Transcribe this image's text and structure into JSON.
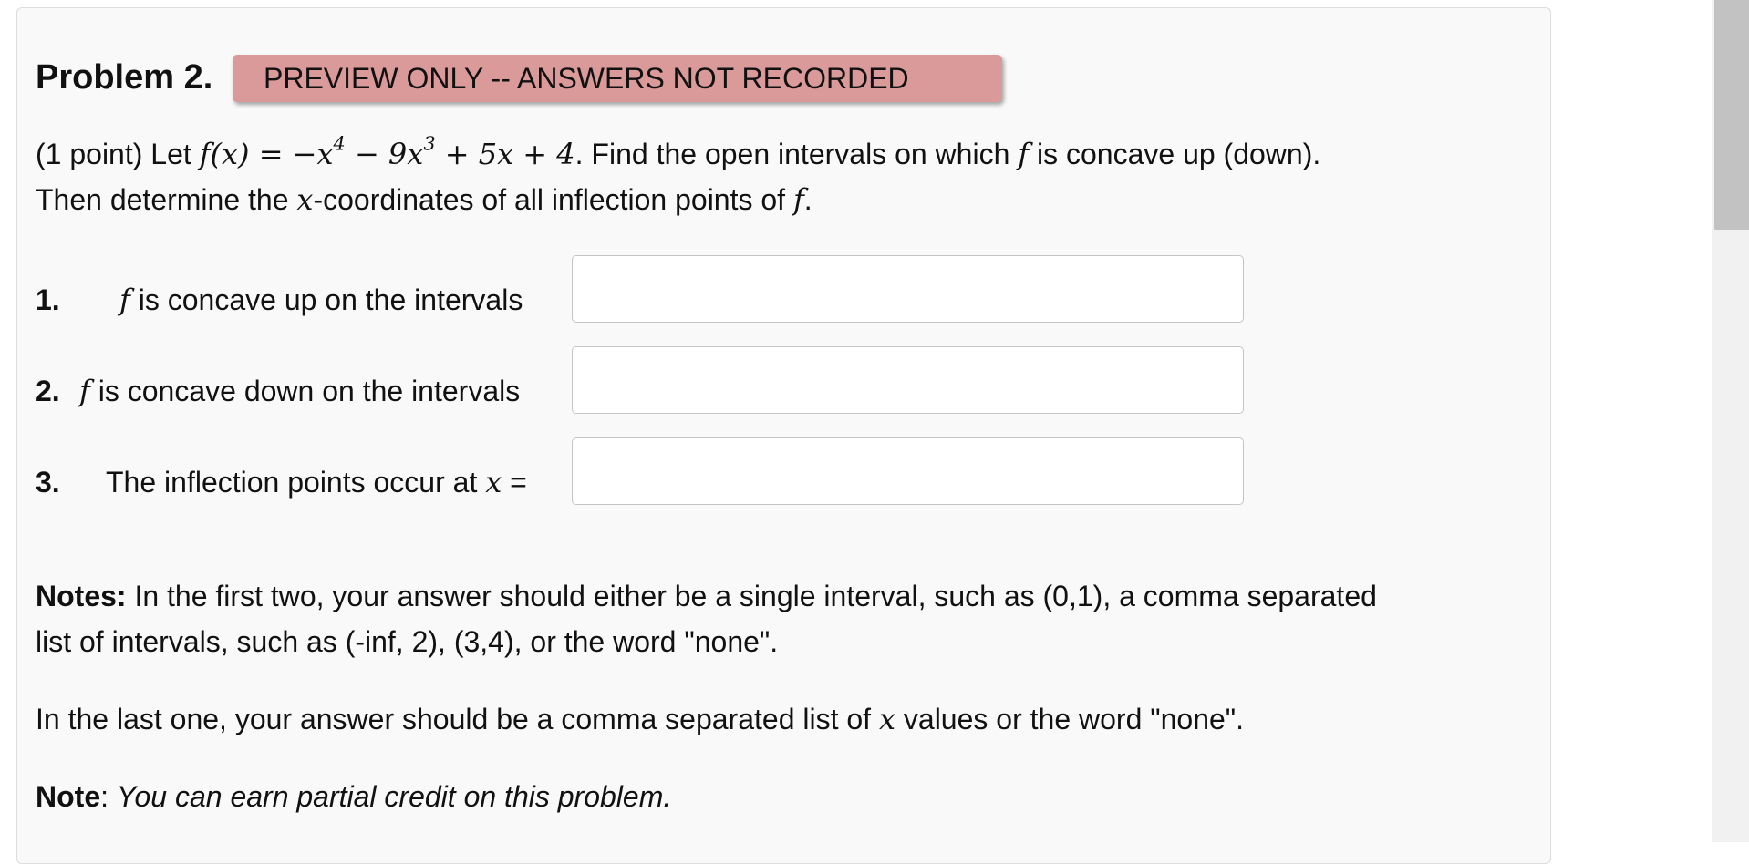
{
  "problem": {
    "title": "Problem 2.",
    "preview_banner": "PREVIEW ONLY -- ANSWERS NOT RECORDED",
    "statement": {
      "points": "(1 point) Let",
      "func_expr": "f(x) = −x",
      "exp4": "4",
      "minus_term": " − 9x",
      "exp3": "3",
      "rest_expr": " + 5x + 4",
      "after_expr": ". Find the open intervals on which",
      "f_symbol": "f",
      "after_f": "is concave up (down).",
      "line2_start": "Then determine the",
      "x_symbol": "x",
      "line2_end": "-coordinates of all inflection points of",
      "f_symbol2": "f",
      "period": "."
    }
  },
  "questions": [
    {
      "number": "1.",
      "f_symbol": "f",
      "label": "is concave up on the intervals",
      "value": "",
      "placeholder": ""
    },
    {
      "number": "2.",
      "f_symbol": "f",
      "label": "is concave down on the intervals",
      "value": "",
      "placeholder": ""
    },
    {
      "number": "3.",
      "label": "The inflection points occur at",
      "x_symbol": "x",
      "equals": "=",
      "value": "",
      "placeholder": ""
    }
  ],
  "notes": {
    "notes_label": "Notes:",
    "notes_line1": "In the first two, your answer should either be a single interval, such as (0,1), a comma separated",
    "notes_line2": "list of intervals, such as (-inf, 2), (3,4), or the word \"none\".",
    "last_start": "In the last one, your answer should be a comma separated list of",
    "last_x": "x",
    "last_end": "values or the word \"none\".",
    "note_label": "Note",
    "note_colon": ":",
    "note_text": "You can earn partial credit on this problem."
  },
  "colors": {
    "banner_bg": "#d99a99",
    "panel_bg": "#f9f9f9",
    "scroll_thumb": "#c2c2c2"
  }
}
